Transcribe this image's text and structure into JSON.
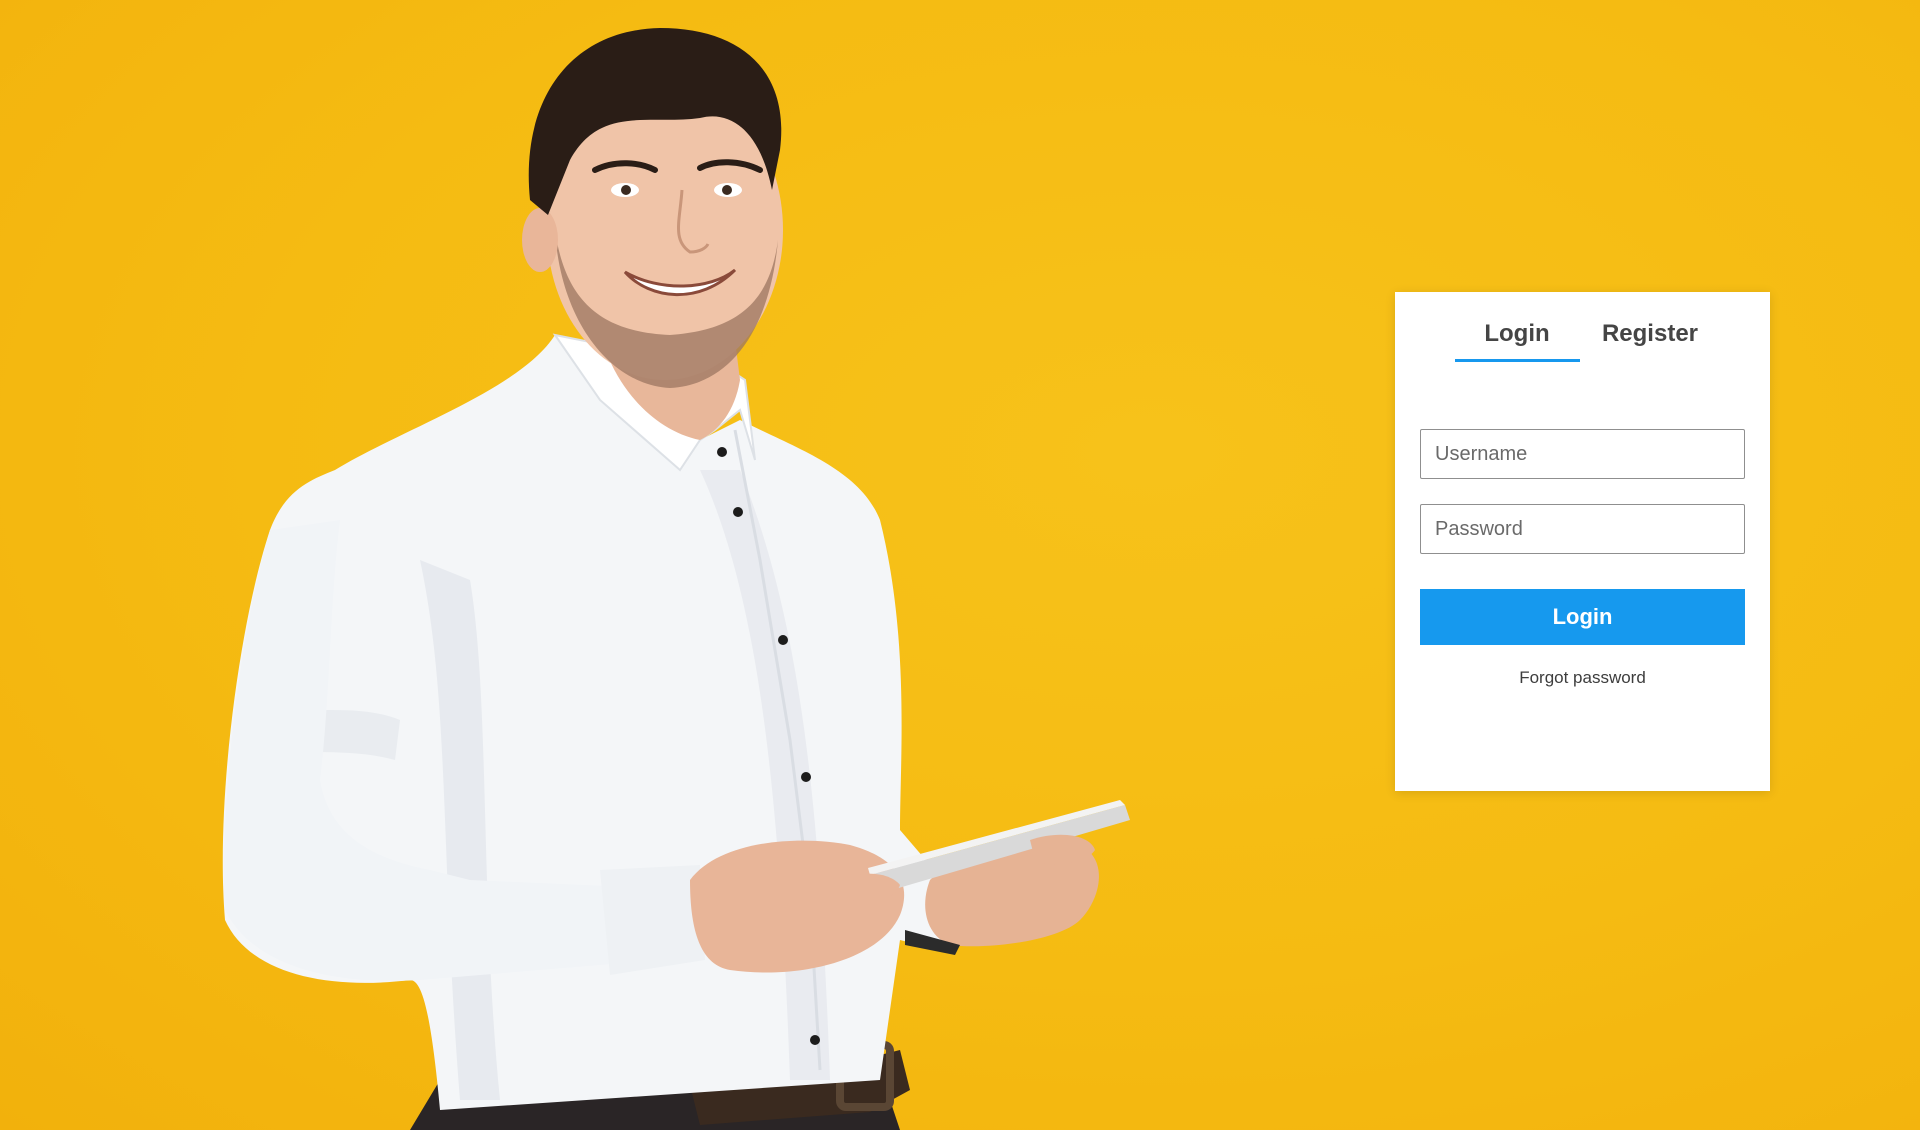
{
  "hero": {
    "image": "man-holding-tablet-photo"
  },
  "auth_card": {
    "tabs": [
      {
        "label": "Login",
        "active": true
      },
      {
        "label": "Register",
        "active": false
      }
    ],
    "username": {
      "placeholder": "Username",
      "value": ""
    },
    "password": {
      "placeholder": "Password",
      "value": ""
    },
    "submit_label": "Login",
    "forgot_label": "Forgot password"
  },
  "colors": {
    "background": "#f5bb12",
    "accent": "#1699ee",
    "card": "#ffffff"
  }
}
